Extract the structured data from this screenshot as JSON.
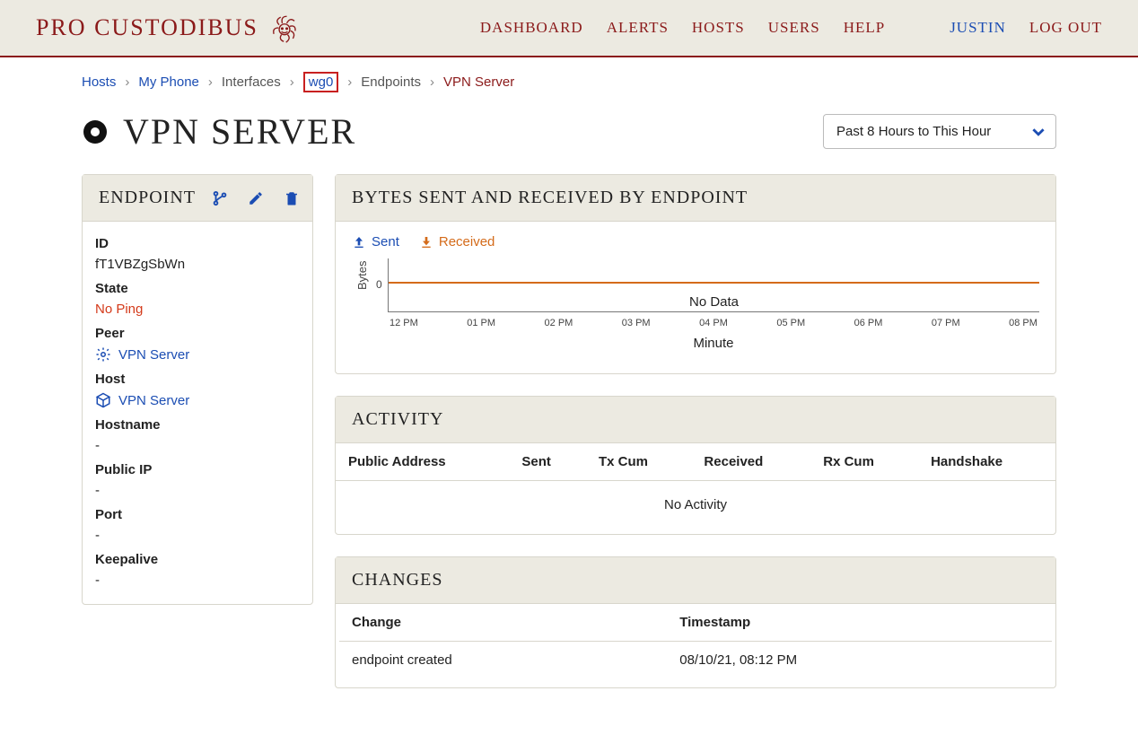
{
  "brand": "PRO CUSTODIBUS",
  "nav": {
    "dashboard": "DASHBOARD",
    "alerts": "ALERTS",
    "hosts": "HOSTS",
    "users": "USERS",
    "help": "HELP",
    "user": "JUSTIN",
    "logout": "LOG OUT"
  },
  "breadcrumb": {
    "hosts": "Hosts",
    "myphone": "My Phone",
    "interfaces": "Interfaces",
    "wg0": "wg0",
    "endpoints": "Endpoints",
    "current": "VPN Server"
  },
  "page_title": "VPN SERVER",
  "range_select": "Past 8 Hours to This Hour",
  "endpoint_panel": {
    "title": "ENDPOINT",
    "id_label": "ID",
    "id_value": "fT1VBZgSbWn",
    "state_label": "State",
    "state_value": "No Ping",
    "peer_label": "Peer",
    "peer_value": "VPN Server",
    "host_label": "Host",
    "host_value": "VPN Server",
    "hostname_label": "Hostname",
    "hostname_value": "-",
    "public_ip_label": "Public IP",
    "public_ip_value": "-",
    "port_label": "Port",
    "port_value": "-",
    "keepalive_label": "Keepalive",
    "keepalive_value": "-"
  },
  "chart_card": {
    "title": "BYTES SENT AND RECEIVED BY ENDPOINT",
    "sent": "Sent",
    "received": "Received",
    "ylabel": "Bytes",
    "xlabel": "Minute",
    "no_data": "No Data",
    "tick0": "0"
  },
  "chart_data": {
    "type": "line",
    "title": "Bytes Sent and Received by Endpoint",
    "xlabel": "Minute",
    "ylabel": "Bytes",
    "categories": [
      "12 PM",
      "01 PM",
      "02 PM",
      "03 PM",
      "04 PM",
      "05 PM",
      "06 PM",
      "07 PM",
      "08 PM"
    ],
    "series": [
      {
        "name": "Sent",
        "values": [
          0,
          0,
          0,
          0,
          0,
          0,
          0,
          0,
          0
        ]
      },
      {
        "name": "Received",
        "values": [
          0,
          0,
          0,
          0,
          0,
          0,
          0,
          0,
          0
        ]
      }
    ],
    "ylim": [
      0,
      0
    ],
    "note": "No Data"
  },
  "activity_card": {
    "title": "ACTIVITY",
    "cols": {
      "public_address": "Public Address",
      "sent": "Sent",
      "tx_cum": "Tx Cum",
      "received": "Received",
      "rx_cum": "Rx Cum",
      "handshake": "Handshake"
    },
    "empty": "No Activity"
  },
  "changes_card": {
    "title": "CHANGES",
    "cols": {
      "change": "Change",
      "timestamp": "Timestamp"
    },
    "rows": [
      {
        "change": "endpoint created",
        "timestamp": "08/10/21, 08:12 PM"
      }
    ]
  }
}
